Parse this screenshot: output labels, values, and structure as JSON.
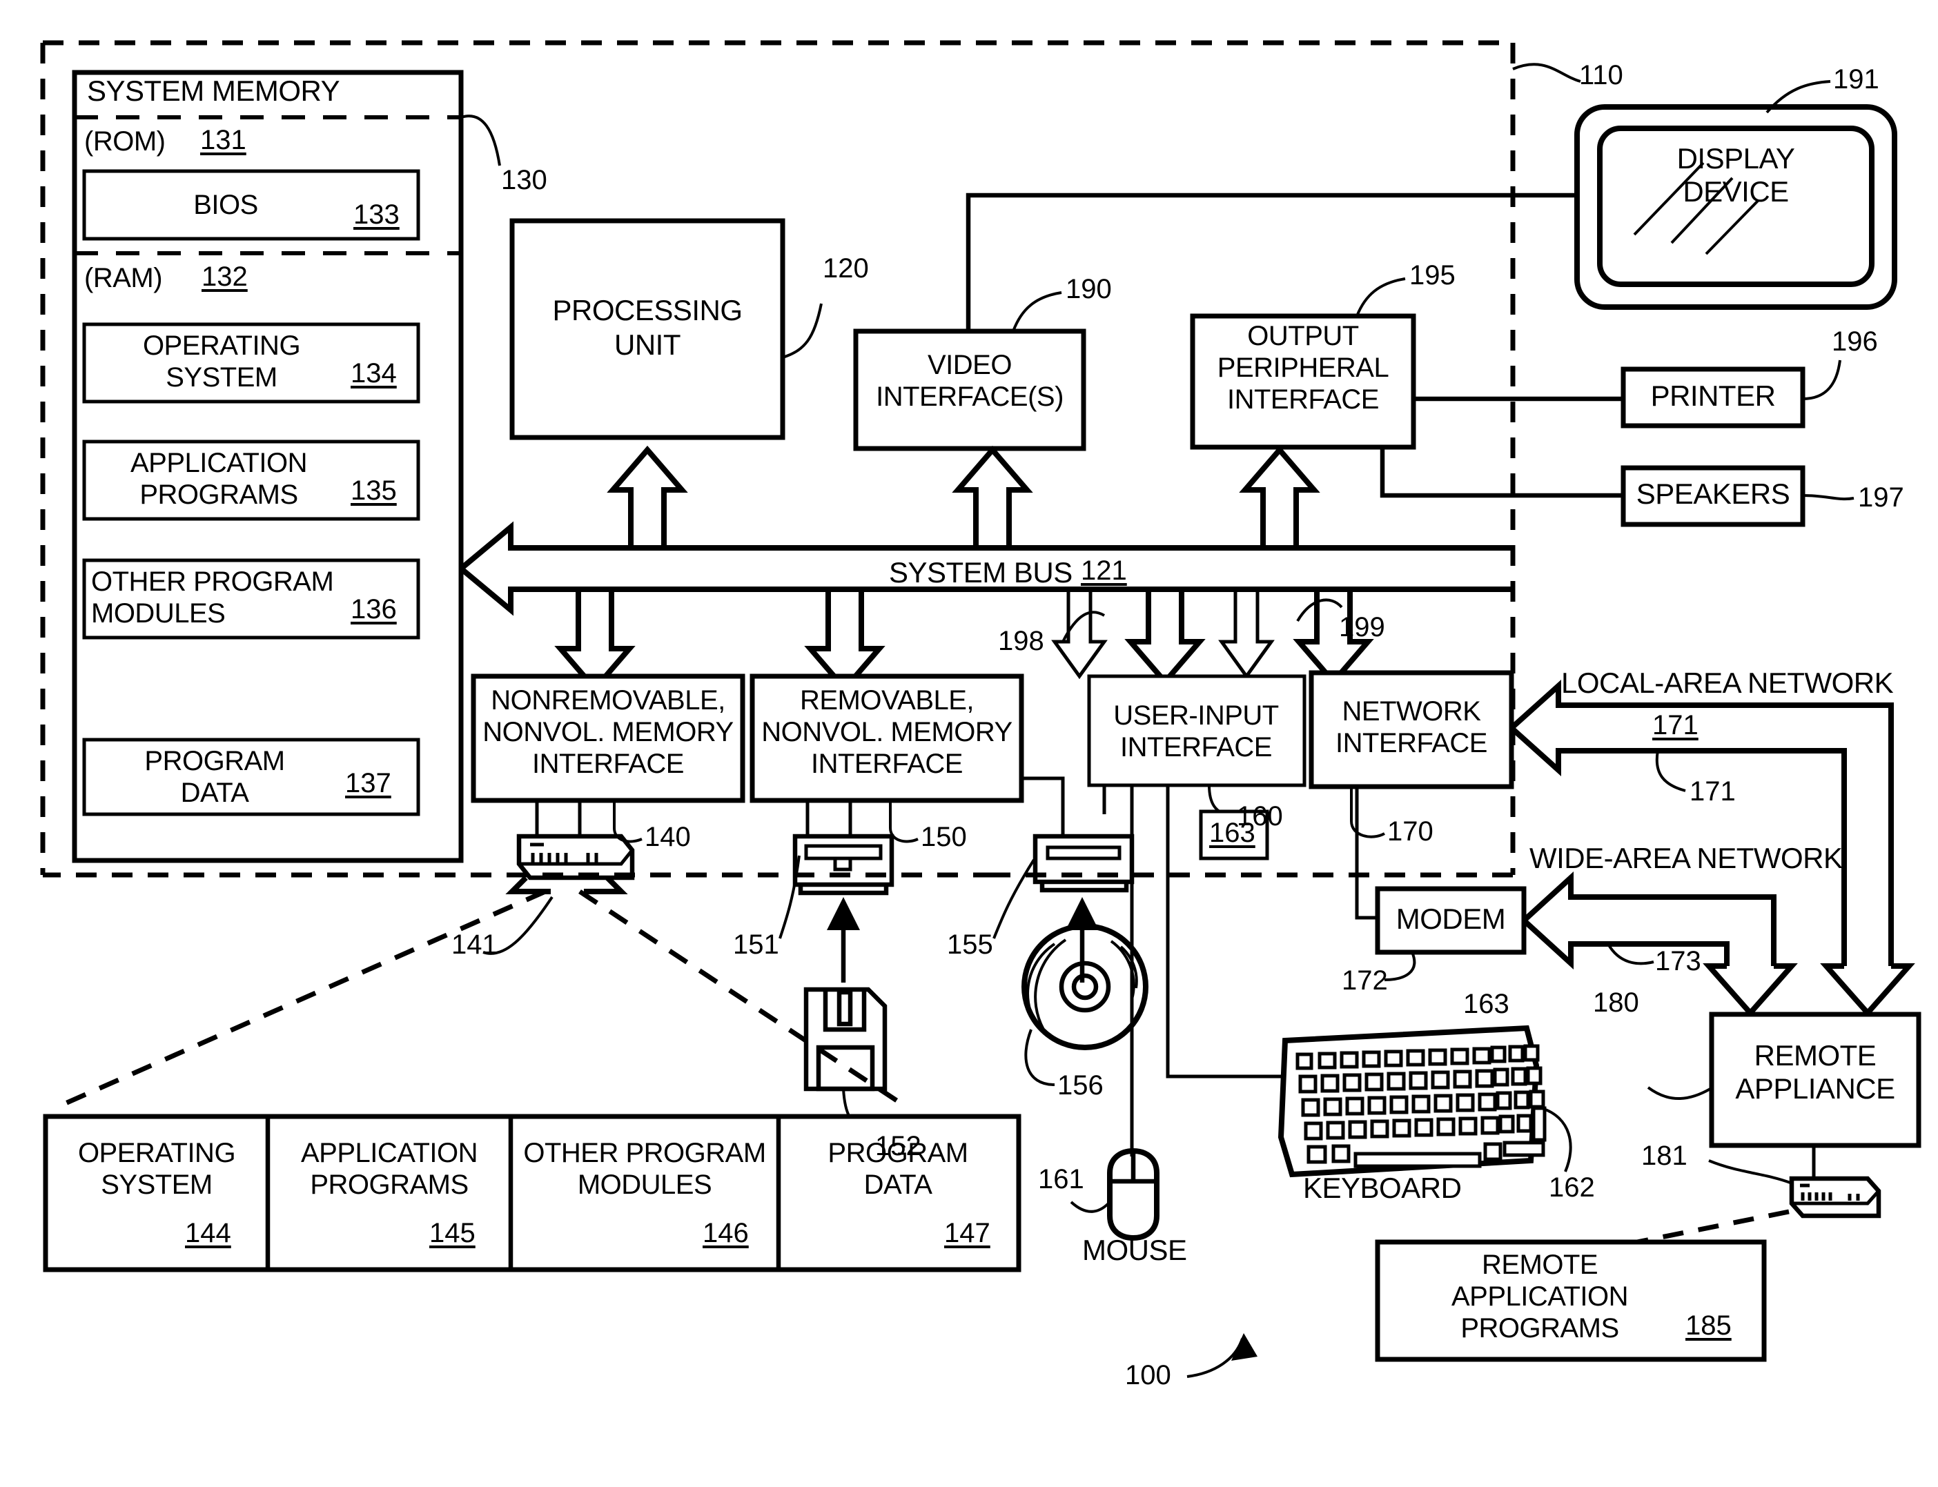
{
  "figure": {
    "system_ref": "100",
    "computer_boundary_ref": "110"
  },
  "system_memory": {
    "title": "SYSTEM MEMORY",
    "ref": "130",
    "rom": {
      "label": "(ROM)",
      "ref": "131",
      "items": [
        {
          "label": "BIOS",
          "ref": "133"
        }
      ]
    },
    "ram": {
      "label": "(RAM)",
      "ref": "132",
      "items": [
        {
          "line1": "OPERATING",
          "line2": "SYSTEM",
          "ref": "134"
        },
        {
          "line1": "APPLICATION",
          "line2": "PROGRAMS",
          "ref": "135"
        },
        {
          "line1": "OTHER PROGRAM",
          "line2": "MODULES",
          "ref": "136"
        },
        {
          "line1": "PROGRAM",
          "line2": "DATA",
          "ref": "137"
        }
      ]
    }
  },
  "processing_unit": {
    "line1": "PROCESSING",
    "line2": "UNIT",
    "ref": "120"
  },
  "system_bus": {
    "label": "SYSTEM BUS",
    "ref": "121"
  },
  "interfaces": {
    "video": {
      "line1": "VIDEO",
      "line2": "INTERFACE(S)",
      "ref": "190"
    },
    "output_peripheral": {
      "line1": "OUTPUT",
      "line2": "PERIPHERAL",
      "line3": "INTERFACE",
      "ref": "195"
    },
    "nonremovable_memory": {
      "line1": "NONREMOVABLE,",
      "line2": "NONVOL. MEMORY",
      "line3": "INTERFACE",
      "ref": "140"
    },
    "removable_memory": {
      "line1": "REMOVABLE,",
      "line2": "NONVOL. MEMORY",
      "line3": "INTERFACE",
      "ref": "150"
    },
    "user_input": {
      "line1": "USER-INPUT",
      "line2": "INTERFACE",
      "ref": "160"
    },
    "network": {
      "line1": "NETWORK",
      "line2": "INTERFACE",
      "ref": "170"
    }
  },
  "bus_arrow_refs": {
    "left": "198",
    "right": "199"
  },
  "output_devices": {
    "display": {
      "line1": "DISPLAY",
      "line2": "DEVICE",
      "ref": "191"
    },
    "printer": {
      "label": "PRINTER",
      "ref": "196"
    },
    "speakers": {
      "label": "SPEAKERS",
      "ref": "197"
    }
  },
  "storage_media": {
    "hard_drive": {
      "ref": "141"
    },
    "floppy_drive": {
      "ref": "151"
    },
    "floppy_disk": {
      "ref": "152"
    },
    "optical_drive": {
      "ref": "155"
    },
    "optical_disc": {
      "ref": "156"
    }
  },
  "input_devices": {
    "mouse": {
      "label": "MOUSE",
      "ref": "161"
    },
    "keyboard": {
      "label": "KEYBOARD",
      "ref": "162"
    },
    "user_input_box_ref": "163",
    "modem_side_ref": "163"
  },
  "networks": {
    "lan": {
      "label": "LOCAL-AREA NETWORK",
      "ref_underlined": "171",
      "ref_plain": "171"
    },
    "wan": {
      "label": "WIDE-AREA NETWORK",
      "ref": "173"
    },
    "modem": {
      "label": "MODEM",
      "ref": "172"
    }
  },
  "remote": {
    "appliance": {
      "line1": "REMOTE",
      "line2": "APPLIANCE",
      "ref": "180"
    },
    "appliance_drive_ref": "181",
    "programs": {
      "line1": "REMOTE",
      "line2": "APPLICATION",
      "line3": "PROGRAMS",
      "ref": "185"
    }
  },
  "disk_contents_table": {
    "columns": [
      {
        "line1": "OPERATING",
        "line2": "SYSTEM",
        "ref": "144"
      },
      {
        "line1": "APPLICATION",
        "line2": "PROGRAMS",
        "ref": "145"
      },
      {
        "line1": "OTHER PROGRAM",
        "line2": "MODULES",
        "ref": "146"
      },
      {
        "line1": "PROGRAM",
        "line2": "DATA",
        "ref": "147"
      }
    ]
  }
}
